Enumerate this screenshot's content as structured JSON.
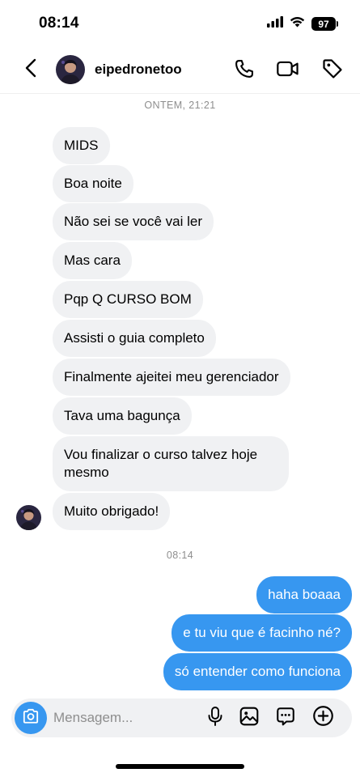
{
  "status_bar": {
    "time": "08:14",
    "battery": "97"
  },
  "header": {
    "username": "eipedronetoo",
    "icons": [
      "back-icon",
      "phone-icon",
      "video-camera-icon",
      "tag-icon"
    ]
  },
  "conversation": {
    "timestamp_1": "ONTEM, 21:21",
    "incoming": [
      "MIDS",
      "Boa noite",
      "Não sei se você vai ler",
      "Mas cara",
      "Pqp Q CURSO BOM",
      "Assisti o guia completo",
      "Finalmente ajeitei meu gerenciador",
      "Tava uma bagunça",
      "Vou finalizar o curso talvez hoje mesmo",
      "Muito obrigado!"
    ],
    "timestamp_2": "08:14",
    "outgoing": [
      "haha boaaa",
      "e tu viu que é facinho né?",
      "só entender como funciona"
    ]
  },
  "composer": {
    "placeholder": "Mensagem...",
    "icons": [
      "camera-icon",
      "microphone-icon",
      "gallery-icon",
      "sticker-icon",
      "add-icon"
    ]
  },
  "colors": {
    "accent": "#3797f0",
    "incoming_bubble": "#f0f1f3",
    "timestamp": "#8e8e8e"
  }
}
